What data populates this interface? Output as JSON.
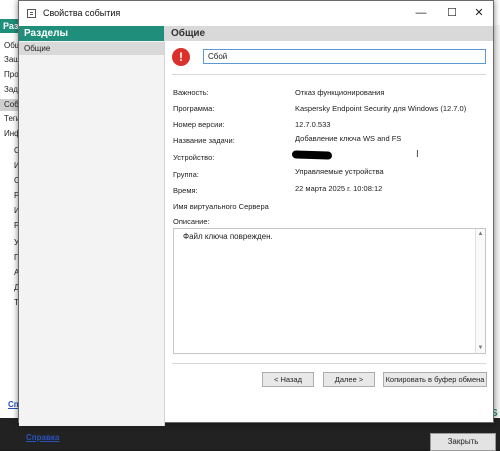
{
  "background_window": {
    "header": "Разде",
    "items": [
      "Общи",
      "Защи",
      "Прогр",
      "Задач",
      "Собы",
      "Теги",
      "Инфо",
      "О",
      "И",
      "С",
      "Р",
      "И",
      "Р",
      "У",
      "П",
      "А",
      "Д",
      "Т"
    ],
    "help": "Спр",
    "close_button": "Закрыть"
  },
  "dialog": {
    "title": "Свойства события",
    "minimize": "—",
    "maximize": "☐",
    "close": "✕",
    "sections_header": "Разделы",
    "sections": [
      "Общие"
    ],
    "help_link": "Справка",
    "section_title": "Общие",
    "event_name": "Сбой",
    "fields": [
      {
        "label": "Важность:",
        "value": "Отказ функционирования"
      },
      {
        "label": "Программа:",
        "value": "Kaspersky Endpoint Security для Windows (12.7.0)"
      },
      {
        "label": "Номер версии:",
        "value": "12.7.0.533"
      },
      {
        "label": "Название задачи:",
        "value": "Добавление ключа WS and FS"
      },
      {
        "label": "Устройство:",
        "value": ""
      },
      {
        "label": "Группа:",
        "value": "Управляемые устройства"
      },
      {
        "label": "Время:",
        "value": "22 марта 2025 г. 10:08:12"
      },
      {
        "label": "Имя виртуального Сервера",
        "value": ""
      }
    ],
    "description_label": "Описание:",
    "description": "Файл ключа поврежден.",
    "buttons": {
      "back": "< Назад",
      "next": "Далее >",
      "copy": "Копировать в буфер обмена"
    },
    "colors": {
      "accent": "#1f8f7b",
      "error": "#d9322d",
      "link": "#2a52be"
    },
    "icons": {
      "error": "error-icon",
      "app": "window-icon"
    }
  }
}
